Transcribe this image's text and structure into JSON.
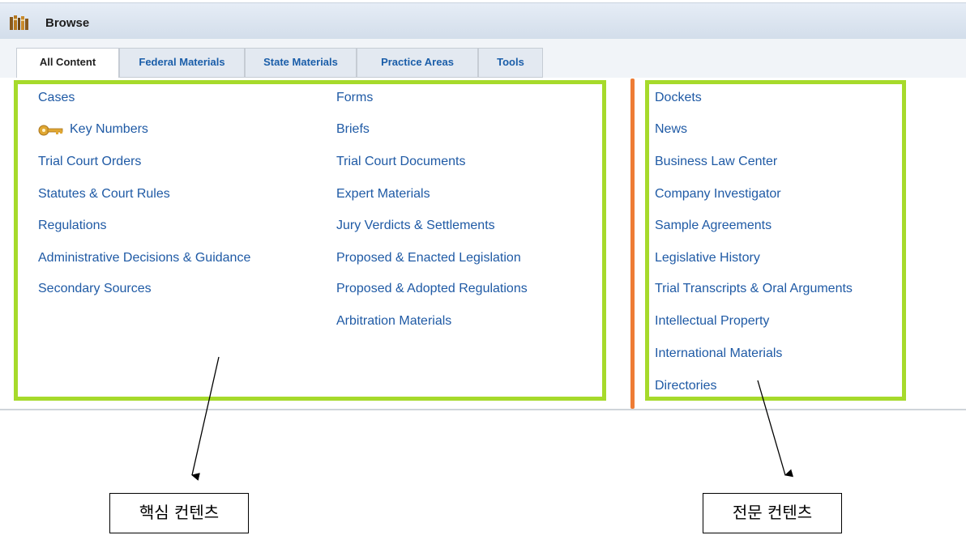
{
  "header": {
    "title": "Browse",
    "icon": "books-icon"
  },
  "tabs": [
    {
      "label": "All Content",
      "active": true
    },
    {
      "label": "Federal Materials"
    },
    {
      "label": "State Materials"
    },
    {
      "label": "Practice Areas"
    },
    {
      "label": "Tools"
    }
  ],
  "core_col1": [
    "Cases",
    "Key Numbers",
    "Trial Court Orders",
    "Statutes & Court Rules",
    "Regulations",
    "Administrative Decisions & Guidance",
    "Secondary Sources"
  ],
  "core_col2": [
    "Forms",
    "Briefs",
    "Trial Court Documents",
    "Expert Materials",
    "Jury Verdicts & Settlements",
    "Proposed & Enacted Legislation",
    "Proposed & Adopted Regulations",
    "Arbitration Materials"
  ],
  "specialty": [
    "Dockets",
    "News",
    "Business Law Center",
    "Company Investigator",
    "Sample Agreements",
    "Legislative History",
    "Trial Transcripts & Oral Arguments",
    "Intellectual Property",
    "International Materials",
    "Directories"
  ],
  "annotations": {
    "core_label": "핵심 컨텐츠",
    "specialty_label": "전문 컨텐츠"
  },
  "colors": {
    "link": "#1f5aa5",
    "highlight_box": "#a6da2b",
    "divider": "#ee7c35"
  }
}
